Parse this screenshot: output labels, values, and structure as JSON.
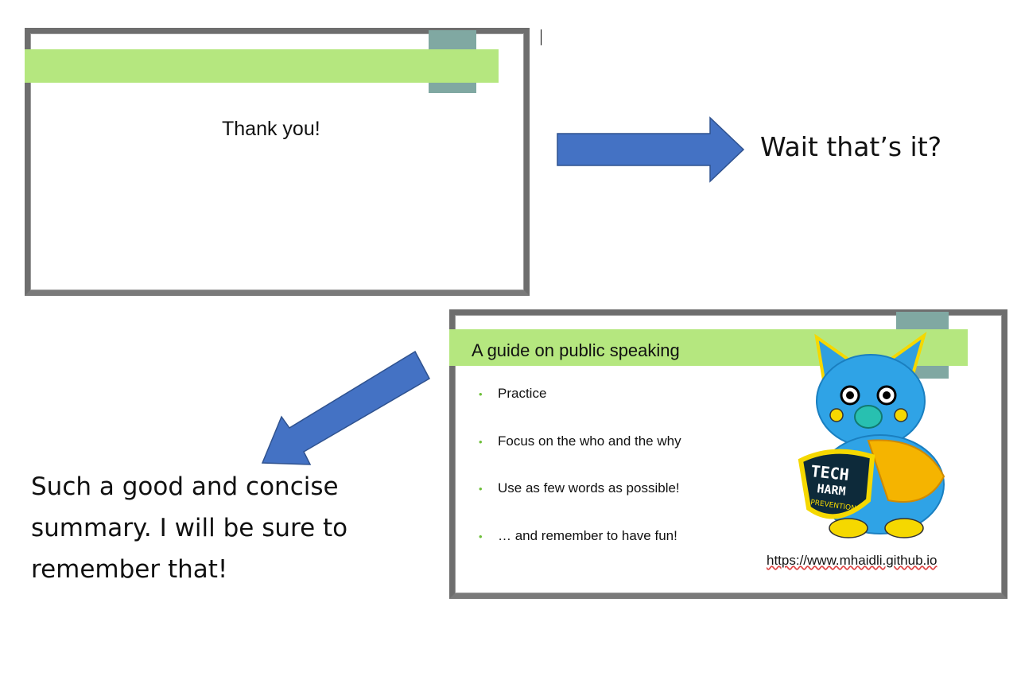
{
  "slide1": {
    "title": "Thank you!"
  },
  "slide2": {
    "title": "A guide on public speaking",
    "bullets": [
      "Practice",
      "Focus on the who and the why",
      "Use as few words as possible!",
      "… and remember to have fun!"
    ],
    "url": "https://www.mhaidli.github.io",
    "mascot_badge": {
      "line1": "TECH",
      "line2": "HARM",
      "line3": "PREVENTION"
    }
  },
  "captions": {
    "reaction1": "Wait that’s it?",
    "reaction2": "Such a good and concise summary. I will be sure to remember that!"
  },
  "colors": {
    "green_bar": "#b5e77f",
    "teal_tab": "#80a8a2",
    "arrow_fill": "#4472c4",
    "bullet_dot": "#6ebf3a"
  }
}
